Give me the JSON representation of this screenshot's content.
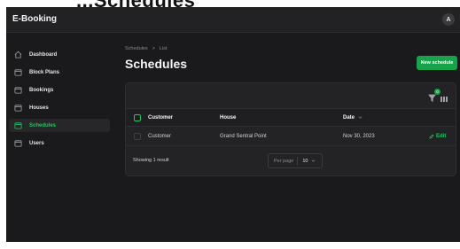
{
  "header": {
    "brand": "E-Booking",
    "avatar_initial": "A"
  },
  "cropped_top_text": "...Schedules",
  "sidebar": {
    "items": [
      {
        "label": "Dashboard",
        "icon": "home-icon",
        "active": false
      },
      {
        "label": "Block Plans",
        "icon": "folder-icon",
        "active": false
      },
      {
        "label": "Bookings",
        "icon": "folder-icon",
        "active": false
      },
      {
        "label": "Houses",
        "icon": "folder-icon",
        "active": false
      },
      {
        "label": "Schedules",
        "icon": "folder-icon",
        "active": true
      },
      {
        "label": "Users",
        "icon": "folder-icon",
        "active": false
      }
    ]
  },
  "breadcrumb": {
    "parent": "Schedules",
    "separator": ">",
    "current": "List"
  },
  "page": {
    "title": "Schedules",
    "new_button": "New schedule"
  },
  "table": {
    "filter_badge": "0",
    "columns": [
      "Customer",
      "House",
      "Date"
    ],
    "rows": [
      {
        "customer": "Customer",
        "house": "Grand Sentral Point",
        "date": "Nov 30, 2023",
        "action": "Edit"
      }
    ],
    "footer": {
      "showing": "Showing 1 result",
      "per_page_label": "Per page",
      "per_page_value": "10"
    }
  },
  "colors": {
    "accent": "#16a34a",
    "accent_text": "#22c55e",
    "background": "#1a1a1c",
    "panel": "#232326"
  }
}
